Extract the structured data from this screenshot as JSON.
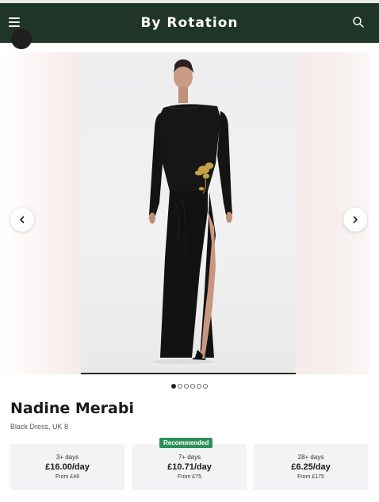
{
  "header": {
    "brand": "By Rotation",
    "menu_icon": "hamburger-menu-icon",
    "search_icon": "search-icon",
    "background": "#1f3528"
  },
  "gallery": {
    "prev_icon": "chevron-left-icon",
    "next_icon": "chevron-right-icon",
    "slide_count": 6,
    "active_slide": 1,
    "photo_alt": "Model wearing black long-sleeve dress with gold floral embellishment and thigh slit"
  },
  "product": {
    "brand": "Nadine Merabi",
    "subtitle": "Black Dress, UK 8"
  },
  "pricing": {
    "plans": [
      {
        "days": "3+ days",
        "price": "£16.00/day",
        "from": "From £48",
        "recommended": false
      },
      {
        "days": "7+ days",
        "price": "£10.71/day",
        "from": "From £75",
        "recommended": true
      },
      {
        "days": "28+ days",
        "price": "£6.25/day",
        "from": "From £175",
        "recommended": false
      }
    ],
    "recommended_label": "Recommended",
    "recommended_color": "#2f8f5b"
  }
}
